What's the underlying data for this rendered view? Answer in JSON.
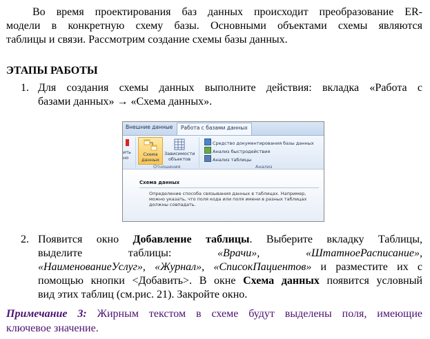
{
  "intro": {
    "line1": "Во время проектирования баз данных происходит преобразование ER-",
    "line2": "модели в конкретную схему базы. Основными объектами схемы являются",
    "line3": "таблицы и связи. Рассмотрим создание схемы базы данных."
  },
  "heading": "ЭТАПЫ РАБОТЫ",
  "step1": {
    "number": "1.",
    "line1": "Для создания схемы данных выполните действия: вкладка «Работа с",
    "line2": "базами данных» → «Схема данных»."
  },
  "ribbon": {
    "tab_prev": "Внешние данные",
    "tab_active": "Работа с базами данных",
    "btn_left_partial": "ить\nно",
    "btn_schema_l1": "Схема",
    "btn_schema_l2": "данных",
    "btn_deps_l1": "Зависимости",
    "btn_deps_l2": "объектов",
    "group_relations": "Отношения",
    "small1": "Средство документирования базы данных",
    "small2": "Анализ быстродействия",
    "small3": "Анализ таблицы",
    "group_analysis": "Анализ",
    "tip_title": "Схема данных",
    "tip_text": "Определение способа связывания данных в таблицах. Например, можно указать, что поля кода или поля имени в разных таблицах должны совпадать."
  },
  "step2": {
    "number": "2.",
    "l1a": "Появится окно ",
    "l1b": "Добавление таблицы",
    "l1c": ". Выберите вкладку Таблицы,",
    "l2a": "выделите",
    "l2b": "таблицы:",
    "l2c": "«Врачи»,",
    "l2d": "«ШтатноеРасписание»,",
    "l3a": "«НаименованиеУслуг»",
    "l3b": ", ",
    "l3c": "«Журнал»",
    "l3d": ", ",
    "l3e": "«СписокПациентов»",
    "l3f": " и разместите их с",
    "l4a": "помощью кнопки <Добавить>. В окне ",
    "l4b": "Схема данных",
    "l4c": " появится условный",
    "l5": "вид этих таблиц (см.рис. 21). Закройте окно."
  },
  "note": {
    "label": "Примечание 3:",
    "line1rest": " Жирным текстом в схеме будут выделены поля, имеющие",
    "line2": "ключевое значение."
  }
}
